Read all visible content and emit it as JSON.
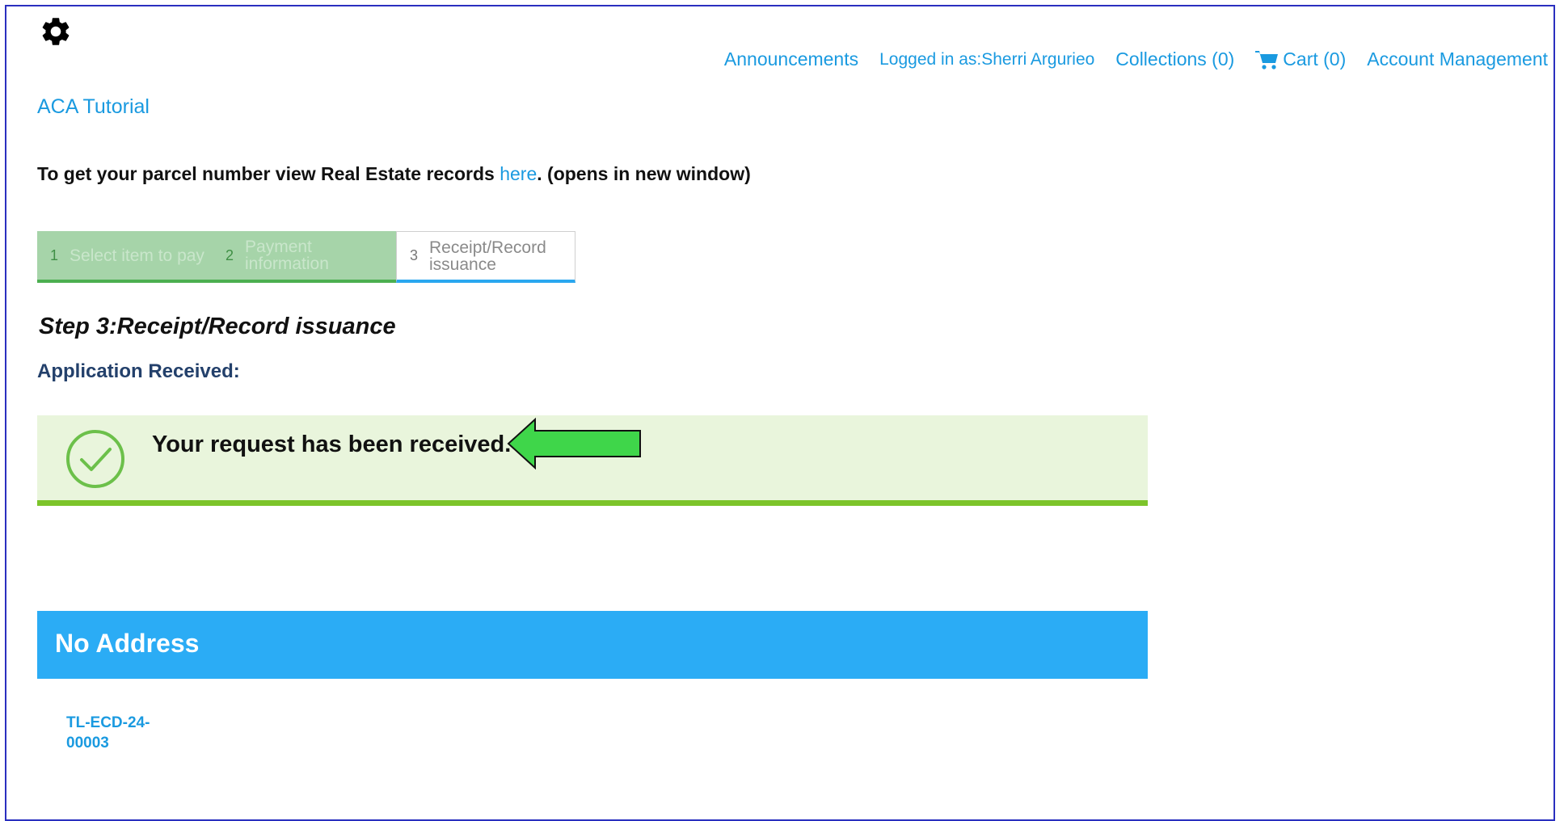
{
  "nav": {
    "announcements": "Announcements",
    "logged_in": "Logged in as:Sherri Argurieo",
    "collections": "Collections (0)",
    "cart": "Cart (0)",
    "account": "Account Management"
  },
  "site_title": "ACA Tutorial",
  "parcel_notice": {
    "before": "To get your parcel number view Real Estate records ",
    "link": "here",
    "after": ". (opens in new window)"
  },
  "steps": [
    {
      "num": "1",
      "label": "Select item to pay"
    },
    {
      "num": "2",
      "label": "Payment information"
    },
    {
      "num": "3",
      "label": "Receipt/Record issuance"
    }
  ],
  "step_title": "Step 3:Receipt/Record issuance",
  "application_received": "Application Received:",
  "success_message": "Your request has been received.",
  "address_header": "No Address",
  "record_number": "TL-ECD-24-00003",
  "colors": {
    "link": "#1a9ae0",
    "success_bg": "#e9f5dc",
    "success_bar": "#7cc42a",
    "header_blue": "#2bacf5",
    "arrow_green": "#3fd64a"
  }
}
